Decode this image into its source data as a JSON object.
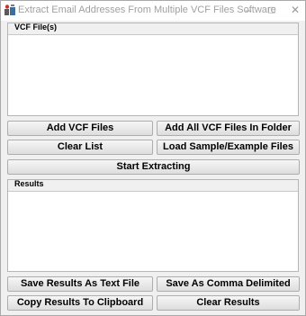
{
  "window": {
    "title": "Extract Email Addresses From Multiple VCF Files Software",
    "icon": "app-icon",
    "controls": {
      "minimize": "–",
      "maximize": "□",
      "close": "✕"
    }
  },
  "vcf_files": {
    "label": "VCF File(s)",
    "items": []
  },
  "buttons": {
    "add_vcf_files": "Add VCF Files",
    "add_all_vcf_files_in_folder": "Add All VCF Files In Folder",
    "clear_list": "Clear List",
    "load_sample": "Load Sample/Example Files",
    "start_extracting": "Start Extracting",
    "save_results_text": "Save Results As Text File",
    "save_comma_delimited": "Save As Comma Delimited",
    "copy_to_clipboard": "Copy Results To Clipboard",
    "clear_results": "Clear Results"
  },
  "results": {
    "label": "Results",
    "content": ""
  }
}
